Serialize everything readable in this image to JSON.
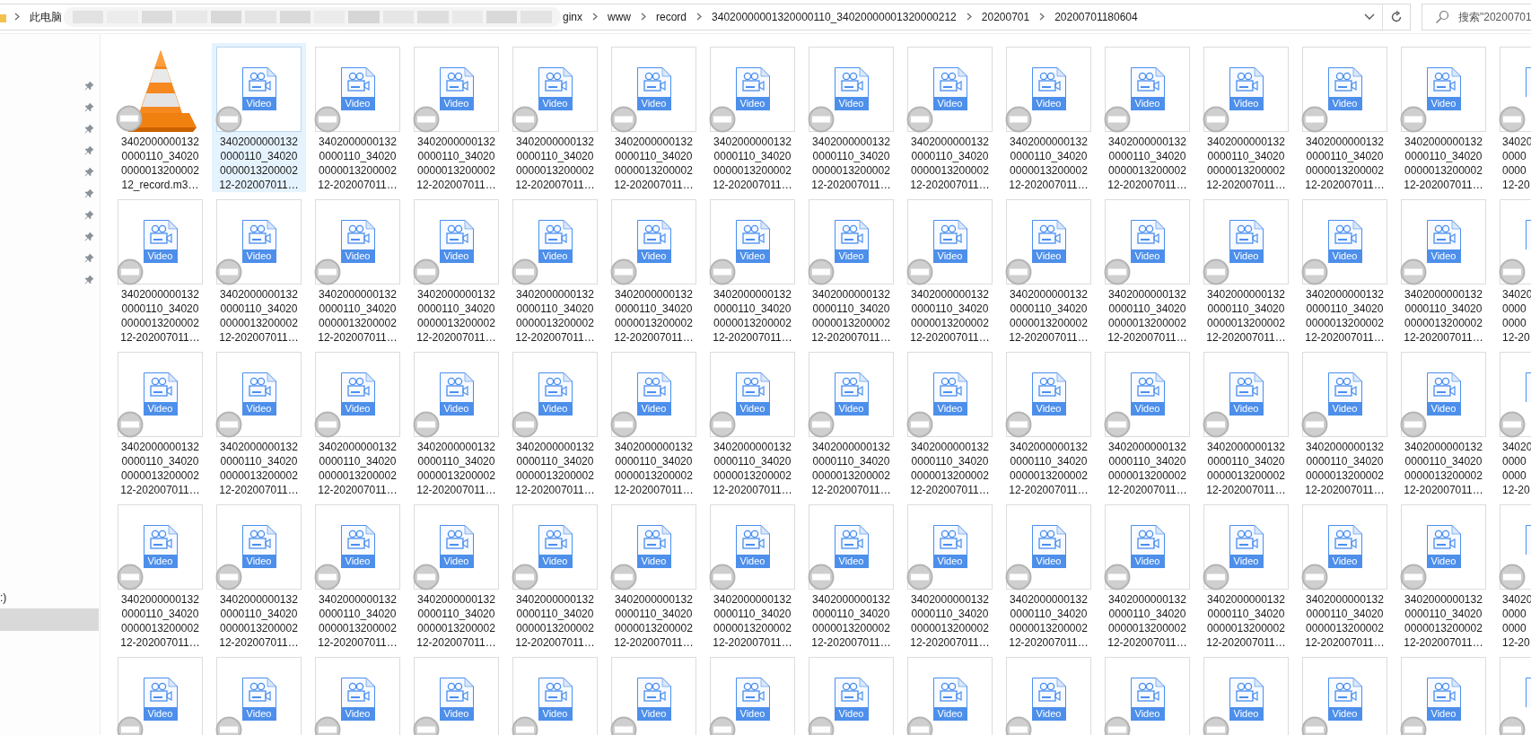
{
  "address": {
    "segments": [
      {
        "kind": "text",
        "label": "此电脑"
      },
      {
        "kind": "redacted"
      },
      {
        "kind": "text",
        "label": "ginx"
      },
      {
        "kind": "text",
        "label": "www"
      },
      {
        "kind": "text",
        "label": "record"
      },
      {
        "kind": "text",
        "label": "34020000001320000110_34020000001320000212"
      },
      {
        "kind": "text",
        "label": "20200701"
      },
      {
        "kind": "text",
        "label": "20200701180604"
      }
    ]
  },
  "search": {
    "placeholder": "搜索\"20200701"
  },
  "sidebar": {
    "quick_access": [
      {
        "pinned": true
      },
      {
        "pinned": true
      },
      {
        "pinned": true
      },
      {
        "pinned": true
      },
      {
        "pinned": true
      },
      {
        "pinned": true
      },
      {
        "pinned": true
      },
      {
        "pinned": true
      },
      {
        "pinned": true
      },
      {
        "pinned": true
      }
    ],
    "drives": [
      {
        "label": ":)",
        "selected": false
      },
      {
        "selected": true
      }
    ]
  },
  "files": [
    {
      "kind": "vlc",
      "name": "34020000001320000110_34020000001320000212_record.m3…",
      "selected": false
    },
    {
      "kind": "video",
      "label": "Video",
      "name": "34020000001320000110_34020000001320000212-202007011…",
      "selected": true
    },
    {
      "kind": "video",
      "label": "Video",
      "name": "34020000001320000110_34020000001320000212-202007011…",
      "selected": false
    },
    {
      "kind": "video",
      "label": "Video",
      "name": "34020000001320000110_34020000001320000212-202007011…",
      "selected": false
    },
    {
      "kind": "video",
      "label": "Video",
      "name": "34020000001320000110_34020000001320000212-202007011…",
      "selected": false
    },
    {
      "kind": "video",
      "label": "Video",
      "name": "34020000001320000110_34020000001320000212-202007011…",
      "selected": false
    },
    {
      "kind": "video",
      "label": "Video",
      "name": "34020000001320000110_34020000001320000212-202007011…",
      "selected": false
    },
    {
      "kind": "video",
      "label": "Video",
      "name": "34020000001320000110_34020000001320000212-202007011…",
      "selected": false
    },
    {
      "kind": "video",
      "label": "Video",
      "name": "34020000001320000110_34020000001320000212-202007011…",
      "selected": false
    },
    {
      "kind": "video",
      "label": "Video",
      "name": "34020000001320000110_34020000001320000212-202007011…",
      "selected": false
    },
    {
      "kind": "video",
      "label": "Video",
      "name": "34020000001320000110_34020000001320000212-202007011…",
      "selected": false
    },
    {
      "kind": "video",
      "label": "Video",
      "name": "34020000001320000110_34020000001320000212-202007011…",
      "selected": false
    },
    {
      "kind": "video",
      "label": "Video",
      "name": "34020000001320000110_34020000001320000212-202007011…",
      "selected": false
    },
    {
      "kind": "video",
      "label": "Video",
      "name": "34020000001320000110_34020000001320000212-202007011…",
      "selected": false
    },
    {
      "kind": "video",
      "name_lines": [
        "34020",
        "0000",
        "0000",
        "12-20"
      ],
      "selected": false
    },
    {
      "kind": "video",
      "label": "Video",
      "name": "34020000001320000110_34020000001320000212-202007011…",
      "selected": false
    },
    {
      "kind": "video",
      "label": "Video",
      "name": "34020000001320000110_34020000001320000212-202007011…",
      "selected": false
    },
    {
      "kind": "video",
      "label": "Video",
      "name": "34020000001320000110_34020000001320000212-202007011…",
      "selected": false
    },
    {
      "kind": "video",
      "label": "Video",
      "name": "34020000001320000110_34020000001320000212-202007011…",
      "selected": false
    },
    {
      "kind": "video",
      "label": "Video",
      "name": "34020000001320000110_34020000001320000212-202007011…",
      "selected": false
    },
    {
      "kind": "video",
      "label": "Video",
      "name": "34020000001320000110_34020000001320000212-202007011…",
      "selected": false
    },
    {
      "kind": "video",
      "label": "Video",
      "name": "34020000001320000110_34020000001320000212-202007011…",
      "selected": false
    },
    {
      "kind": "video",
      "label": "Video",
      "name": "34020000001320000110_34020000001320000212-202007011…",
      "selected": false
    },
    {
      "kind": "video",
      "label": "Video",
      "name": "34020000001320000110_34020000001320000212-202007011…",
      "selected": false
    },
    {
      "kind": "video",
      "label": "Video",
      "name": "34020000001320000110_34020000001320000212-202007011…",
      "selected": false
    },
    {
      "kind": "video",
      "label": "Video",
      "name": "34020000001320000110_34020000001320000212-202007011…",
      "selected": false
    },
    {
      "kind": "video",
      "label": "Video",
      "name": "34020000001320000110_34020000001320000212-202007011…",
      "selected": false
    },
    {
      "kind": "video",
      "label": "Video",
      "name": "34020000001320000110_34020000001320000212-202007011…",
      "selected": false
    },
    {
      "kind": "video",
      "label": "Video",
      "name": "34020000001320000110_34020000001320000212-202007011…",
      "selected": false
    },
    {
      "kind": "video",
      "name_lines": [
        "34020",
        "0000",
        "0000",
        "12-20"
      ],
      "selected": false
    },
    {
      "kind": "video",
      "label": "Video",
      "name": "34020000001320000110_34020000001320000212-202007011…",
      "selected": false
    },
    {
      "kind": "video",
      "label": "Video",
      "name": "34020000001320000110_34020000001320000212-202007011…",
      "selected": false
    },
    {
      "kind": "video",
      "label": "Video",
      "name": "34020000001320000110_34020000001320000212-202007011…",
      "selected": false
    },
    {
      "kind": "video",
      "label": "Video",
      "name": "34020000001320000110_34020000001320000212-202007011…",
      "selected": false
    },
    {
      "kind": "video",
      "label": "Video",
      "name": "34020000001320000110_34020000001320000212-202007011…",
      "selected": false
    },
    {
      "kind": "video",
      "label": "Video",
      "name": "34020000001320000110_34020000001320000212-202007011…",
      "selected": false
    },
    {
      "kind": "video",
      "label": "Video",
      "name": "34020000001320000110_34020000001320000212-202007011…",
      "selected": false
    },
    {
      "kind": "video",
      "label": "Video",
      "name": "34020000001320000110_34020000001320000212-202007011…",
      "selected": false
    },
    {
      "kind": "video",
      "label": "Video",
      "name": "34020000001320000110_34020000001320000212-202007011…",
      "selected": false
    },
    {
      "kind": "video",
      "label": "Video",
      "name": "34020000001320000110_34020000001320000212-202007011…",
      "selected": false
    },
    {
      "kind": "video",
      "label": "Video",
      "name": "34020000001320000110_34020000001320000212-202007011…",
      "selected": false
    },
    {
      "kind": "video",
      "label": "Video",
      "name": "34020000001320000110_34020000001320000212-202007011…",
      "selected": false
    },
    {
      "kind": "video",
      "label": "Video",
      "name": "34020000001320000110_34020000001320000212-202007011…",
      "selected": false
    },
    {
      "kind": "video",
      "label": "Video",
      "name": "34020000001320000110_34020000001320000212-202007011…",
      "selected": false
    },
    {
      "kind": "video",
      "name_lines": [
        "34020",
        "0000",
        "0000",
        "12-20"
      ],
      "selected": false
    },
    {
      "kind": "video",
      "label": "Video",
      "name": "34020000001320000110_34020000001320000212-202007011…",
      "selected": false
    },
    {
      "kind": "video",
      "label": "Video",
      "name": "34020000001320000110_34020000001320000212-202007011…",
      "selected": false
    },
    {
      "kind": "video",
      "label": "Video",
      "name": "34020000001320000110_34020000001320000212-202007011…",
      "selected": false
    },
    {
      "kind": "video",
      "label": "Video",
      "name": "34020000001320000110_34020000001320000212-202007011…",
      "selected": false
    },
    {
      "kind": "video",
      "label": "Video",
      "name": "34020000001320000110_34020000001320000212-202007011…",
      "selected": false
    },
    {
      "kind": "video",
      "label": "Video",
      "name": "34020000001320000110_34020000001320000212-202007011…",
      "selected": false
    },
    {
      "kind": "video",
      "label": "Video",
      "name": "34020000001320000110_34020000001320000212-202007011…",
      "selected": false
    },
    {
      "kind": "video",
      "label": "Video",
      "name": "34020000001320000110_34020000001320000212-202007011…",
      "selected": false
    },
    {
      "kind": "video",
      "label": "Video",
      "name": "34020000001320000110_34020000001320000212-202007011…",
      "selected": false
    },
    {
      "kind": "video",
      "label": "Video",
      "name": "34020000001320000110_34020000001320000212-202007011…",
      "selected": false
    },
    {
      "kind": "video",
      "label": "Video",
      "name": "34020000001320000110_34020000001320000212-202007011…",
      "selected": false
    },
    {
      "kind": "video",
      "label": "Video",
      "name": "34020000001320000110_34020000001320000212-202007011…",
      "selected": false
    },
    {
      "kind": "video",
      "label": "Video",
      "name": "34020000001320000110_34020000001320000212-202007011…",
      "selected": false
    },
    {
      "kind": "video",
      "label": "Video",
      "name": "34020000001320000110_34020000001320000212-202007011…",
      "selected": false
    },
    {
      "kind": "video",
      "name_lines": [
        "34020",
        "0000",
        "0000",
        "12-20"
      ],
      "selected": false
    },
    {
      "kind": "video",
      "label": "Video",
      "selected": false
    },
    {
      "kind": "video",
      "label": "Video",
      "selected": false
    },
    {
      "kind": "video",
      "label": "Video",
      "selected": false
    },
    {
      "kind": "video",
      "label": "Video",
      "selected": false
    },
    {
      "kind": "video",
      "label": "Video",
      "selected": false
    },
    {
      "kind": "video",
      "label": "Video",
      "selected": false
    },
    {
      "kind": "video",
      "label": "Video",
      "selected": false
    },
    {
      "kind": "video",
      "label": "Video",
      "selected": false
    },
    {
      "kind": "video",
      "label": "Video",
      "selected": false
    },
    {
      "kind": "video",
      "label": "Video",
      "selected": false
    },
    {
      "kind": "video",
      "label": "Video",
      "selected": false
    },
    {
      "kind": "video",
      "label": "Video",
      "selected": false
    },
    {
      "kind": "video",
      "label": "Video",
      "selected": false
    },
    {
      "kind": "video",
      "label": "Video",
      "selected": false
    },
    {
      "kind": "video",
      "selected": false
    }
  ]
}
